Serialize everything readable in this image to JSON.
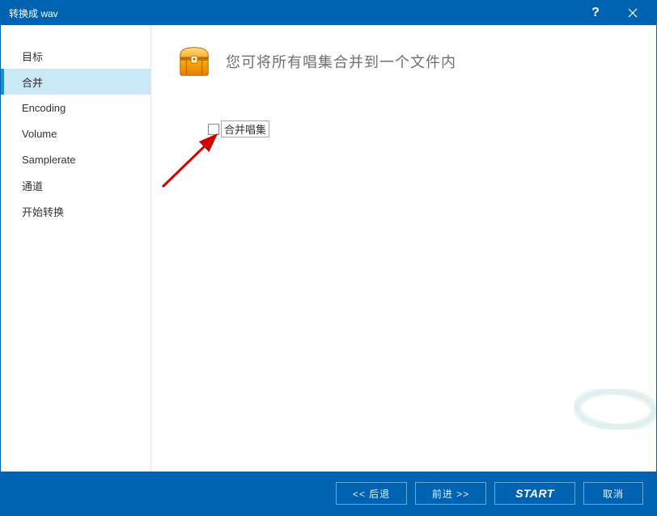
{
  "titlebar": {
    "title": "转换成 wav",
    "help": "?",
    "close": "×"
  },
  "sidebar": {
    "items": [
      {
        "label": "目标",
        "selected": false
      },
      {
        "label": "合并",
        "selected": true
      },
      {
        "label": "Encoding",
        "selected": false
      },
      {
        "label": "Volume",
        "selected": false
      },
      {
        "label": "Samplerate",
        "selected": false
      },
      {
        "label": "通道",
        "selected": false
      },
      {
        "label": "开始转换",
        "selected": false
      }
    ]
  },
  "main": {
    "header_text": "您可将所有唱集合并到一个文件内",
    "checkbox_label": "合并唱集"
  },
  "footer": {
    "back": "<<  后退",
    "forward": "前进  >>",
    "start": "START",
    "cancel": "取消"
  }
}
